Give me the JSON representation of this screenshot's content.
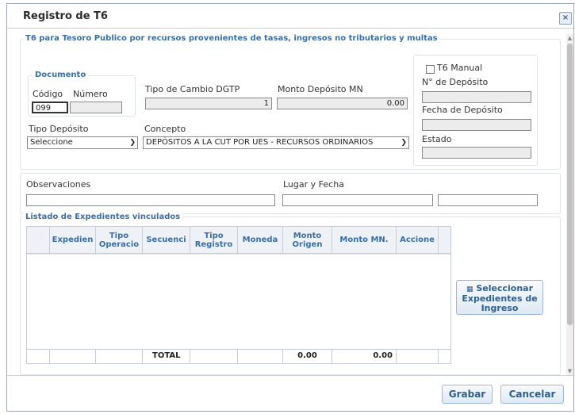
{
  "dialog": {
    "title": "Registro de T6",
    "close_glyph": "×"
  },
  "main_section": {
    "legend": "T6 para Tesoro Publico por recursos provenientes de tasas, ingresos no tributarios y multas"
  },
  "documento": {
    "legend": "Documento",
    "codigo_label": "Código",
    "numero_label": "Número",
    "codigo_value": "099",
    "numero_value": ""
  },
  "tipo_cambio": {
    "label": "Tipo de Cambio DGTP",
    "value": "1"
  },
  "monto_deposito": {
    "label": "Monto Depósito MN",
    "value": "0.00"
  },
  "tipo_deposito": {
    "label": "Tipo Depósito",
    "selected": "Seleccione"
  },
  "concepto": {
    "label": "Concepto",
    "selected": "DEPÓSITOS A LA CUT POR UES - RECURSOS ORDINARIOS"
  },
  "right_panel": {
    "t6_manual_label": "T6 Manual",
    "t6_manual_checked": false,
    "n_deposito_label": "N° de Depósito",
    "fecha_deposito_label": "Fecha de Depósito",
    "estado_label": "Estado"
  },
  "observaciones": {
    "label": "Observaciones",
    "value": ""
  },
  "lugar_fecha": {
    "label": "Lugar y Fecha",
    "lugar_value": "",
    "fecha_value": ""
  },
  "listado": {
    "legend": "Listado de Expedientes vinculados",
    "columns": [
      "",
      "Expedien",
      "Tipo Operacio",
      "Secuenci",
      "Tipo Registro",
      "Moneda",
      "Monto Origen",
      "Monto MN.",
      "Accione"
    ],
    "footer": {
      "total_label": "TOTAL",
      "monto_origen": "0.00",
      "monto_mn": "0.00"
    }
  },
  "seleccionar_button": {
    "label": "Seleccionar Expedientes de Ingreso",
    "icon": "calendar-icon"
  },
  "actions": {
    "grabar": "Grabar",
    "cancelar": "Cancelar"
  },
  "colors": {
    "accent": "#3a6ea5",
    "border": "#9aa7b5"
  }
}
